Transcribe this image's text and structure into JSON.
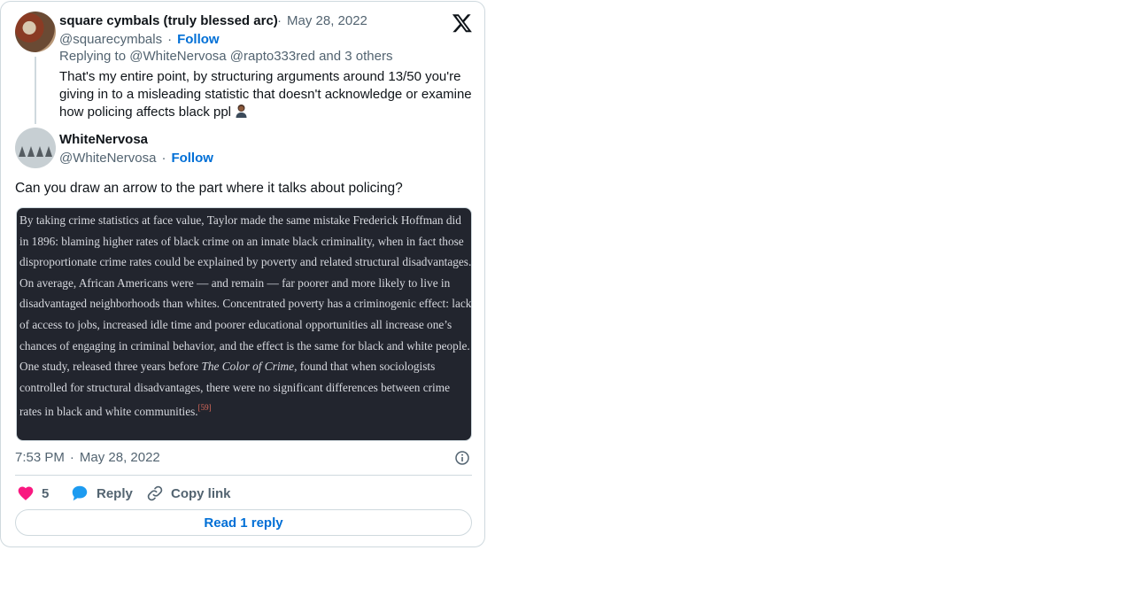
{
  "quoted_tweet": {
    "author_name": "square cymbals (truly blessed arc)",
    "date": "May 28, 2022",
    "handle": "@squarecymbals",
    "follow_label": "Follow",
    "replying_to": "Replying to @WhiteNervosa @rapto333red and 3 others",
    "text": "That's my entire point, by structuring arguments around 13/50 you're giving in to a misleading statistic that doesn't acknowledge or examine how policing affects black ppl"
  },
  "tweet": {
    "author_name": "WhiteNervosa",
    "handle": "@WhiteNervosa",
    "follow_label": "Follow",
    "text": "Can you draw an arrow to the part where it talks about policing?",
    "media": {
      "text_before_italic": "By taking crime statistics at face value, Taylor made the same mistake Frederick Hoffman did in 1896: blaming higher rates of black crime on an innate black criminality, when in fact those disproportionate crime rates could be explained by poverty and related structural disadvantages. On average, African Americans were — and remain — far poorer and more likely to live in disadvantaged neighborhoods than whites. Concentrated poverty has a criminogenic effect: lack of access to jobs, increased idle time and poorer educational opportunities all increase one’s chances of engaging in criminal behavior, and the effect is the same for black and white people. One study, released three years before ",
      "italic": "The Color of Crime",
      "text_after_italic": ", found that when sociologists controlled for structural disadvantages, there were no significant differences between crime rates in black and white communities.",
      "footnote": "[59]"
    },
    "time": "7:53 PM",
    "date": "May 28, 2022",
    "likes": "5",
    "reply_label": "Reply",
    "copy_link_label": "Copy link",
    "read_replies_label": "Read 1 reply"
  },
  "icons": [
    "x-logo-icon",
    "info-icon",
    "heart-icon",
    "reply-bubble-icon",
    "link-icon"
  ],
  "colors": {
    "link": "#006fd6",
    "muted": "#536471",
    "like": "#f91880",
    "reply": "#1d9bf0",
    "border": "#cfd9de"
  }
}
